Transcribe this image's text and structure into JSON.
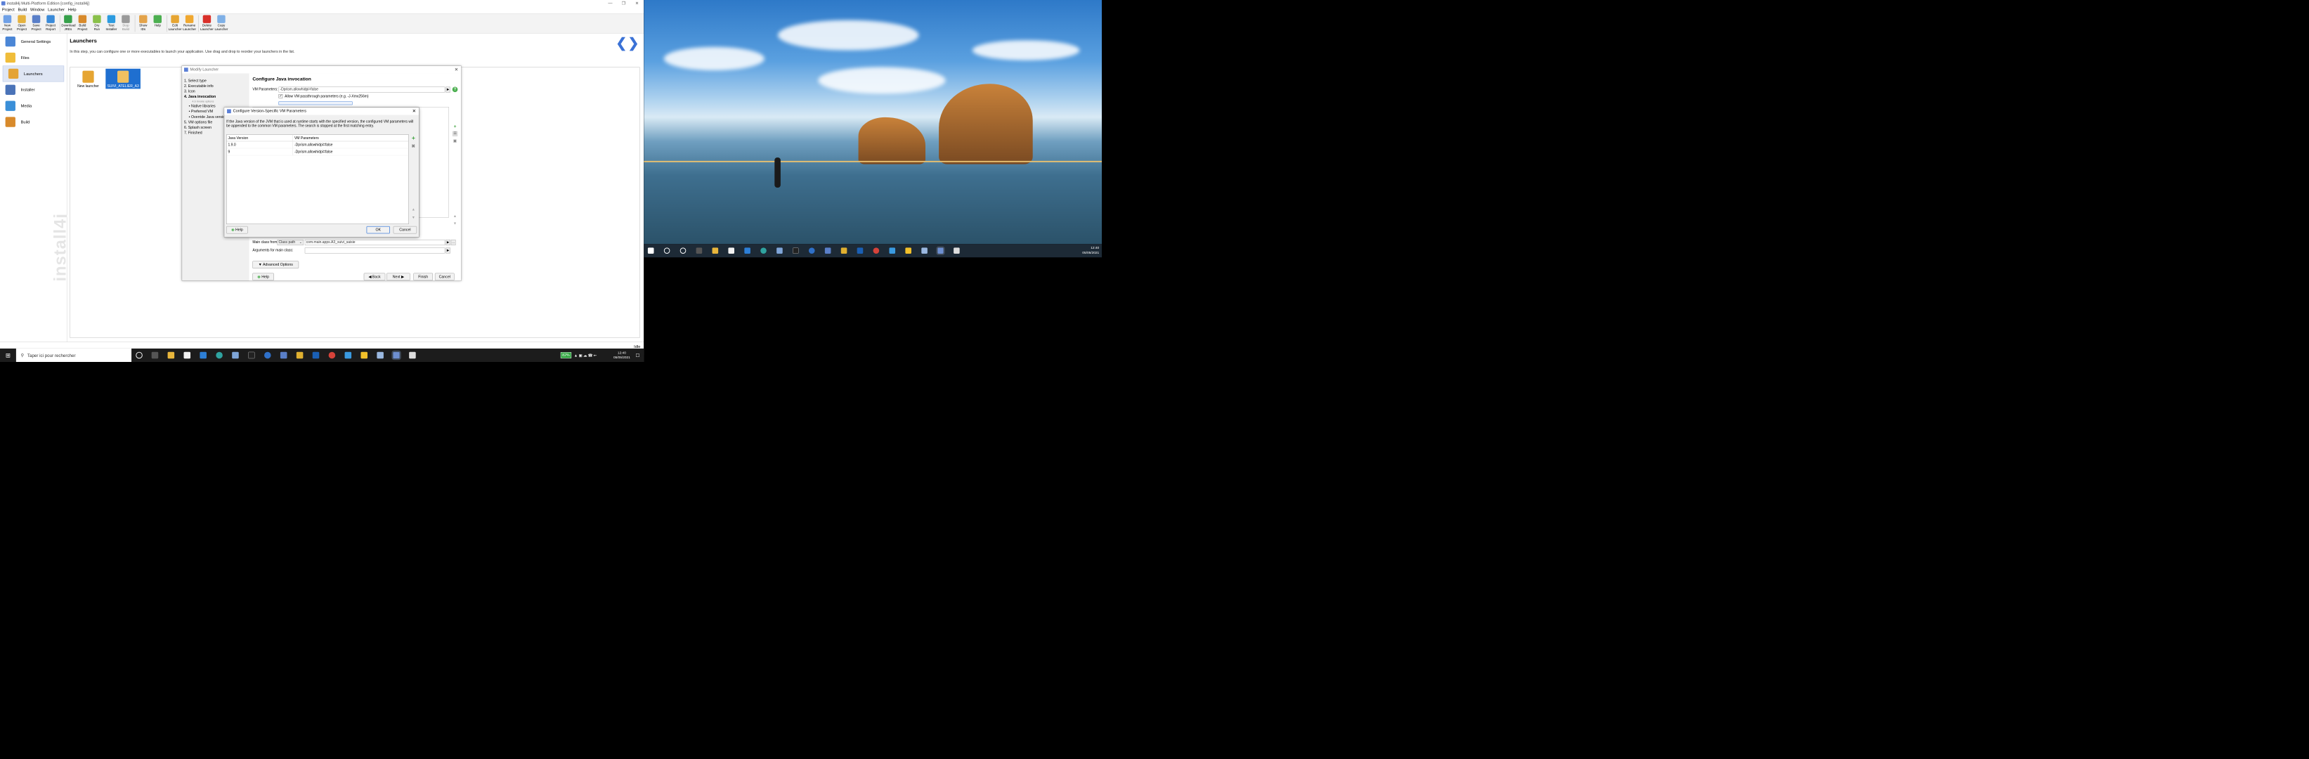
{
  "window": {
    "title": "install4j Multi-Platform Edition [config_install4j]"
  },
  "menu": [
    "Project",
    "Build",
    "Window",
    "Launcher",
    "Help"
  ],
  "toolbar": [
    {
      "label": "New\nProject",
      "color": "#6fa0e6"
    },
    {
      "label": "Open\nProject",
      "color": "#e5b23d"
    },
    {
      "label": "Save\nProject",
      "color": "#5a7fc8"
    },
    {
      "label": "Project\nReport",
      "color": "#3a8ad8"
    },
    {
      "label": "Download\nJREs",
      "color": "#36a04a"
    },
    {
      "label": "Build\nProject",
      "color": "#d88a2b"
    },
    {
      "label": "Dry\nRun",
      "color": "#8ac04a"
    },
    {
      "label": "Test\nInstaller",
      "color": "#2c9be0"
    },
    {
      "label": "Stop\nBuild",
      "color": "#9a9a9a"
    },
    {
      "label": "Show\nIDs",
      "color": "#e3a34a"
    },
    {
      "label": "Help",
      "color": "#4caf50"
    },
    {
      "label": "Edit\nLauncher",
      "color": "#e6a532"
    },
    {
      "label": "Rename\nLauncher",
      "color": "#f0a830"
    },
    {
      "label": "Delete\nLauncher",
      "color": "#d9302a"
    },
    {
      "label": "Copy\nLauncher",
      "color": "#7fb0e6"
    }
  ],
  "sidebar": [
    {
      "label": "General Settings",
      "color": "#4b86d6"
    },
    {
      "label": "Files",
      "color": "#f0bd3a"
    },
    {
      "label": "Launchers",
      "color": "#e4a336"
    },
    {
      "label": "Installer",
      "color": "#4a73b8"
    },
    {
      "label": "Media",
      "color": "#3a8fd8"
    },
    {
      "label": "Build",
      "color": "#d88a2b"
    }
  ],
  "watermark": "install4j",
  "main": {
    "title": "Launchers",
    "description": "In this step, you can configure one or more executables to launch your application. Use drag and drop to reorder your launchers in the list.",
    "launchers": [
      {
        "label": "New launcher"
      },
      {
        "label": "SUIVI_ATELIER_A3"
      }
    ]
  },
  "status": {
    "idle": "Idle"
  },
  "modify_dialog": {
    "title": "Modify Launcher",
    "steps": [
      {
        "label": "1. Select type",
        "cls": ""
      },
      {
        "label": "2. Executable info",
        "cls": ""
      },
      {
        "label": "3. Icon",
        "cls": ""
      },
      {
        "label": "4. Java invocation",
        "cls": "cur"
      },
      {
        "label": "4.b Invoke options",
        "cls": "sub2"
      },
      {
        "label": "• Native libraries",
        "cls": "sub"
      },
      {
        "label": "• Preferred VM",
        "cls": "sub"
      },
      {
        "label": "• Override Java version",
        "cls": "sub"
      },
      {
        "label": "5. VM options file",
        "cls": ""
      },
      {
        "label": "6. Splash screen",
        "cls": ""
      },
      {
        "label": "7. Finished",
        "cls": ""
      }
    ],
    "heading": "Configure Java invocation",
    "vm_params_label": "VM Parameters:",
    "vm_params_value": "-Dprism.allowhidpi=false",
    "passthrough_label": "Allow VM passthrough parameters (e.g. -J-Xmx256m)",
    "main_class_from_label": "Main class from",
    "main_class_source": "Class path",
    "main_class_value": "com.main.apps.A3_suivi_saisie",
    "args_label": "Arguments for main class:",
    "advanced_label": "Advanced Options",
    "help": "Help",
    "back": "Back",
    "next": "Next",
    "finish": "Finish",
    "cancel": "Cancel"
  },
  "vm_dialog": {
    "title": "Configure Version-Specific VM Parameters",
    "message": "If the Java version of the JVM that is used at runtime starts with the specified version, the configured VM parameters will be appended to the common VM parameters. The search is stopped at the first matching entry.",
    "col_version": "Java Version",
    "col_params": "VM Parameters",
    "rows": [
      {
        "version": "1.9.0",
        "params": "-Dprism.allowhidpi=false"
      },
      {
        "version": "9",
        "params": "-Dprism.allowhidpi=false"
      }
    ],
    "help": "Help",
    "ok": "OK",
    "cancel": "Cancel"
  },
  "taskbar_left": {
    "search_placeholder": "Taper ici pour rechercher",
    "battery": "82%",
    "time": "12:40",
    "date": "05/05/2021"
  },
  "taskbar_right": {
    "time": "12:40",
    "date": "05/05/2021"
  }
}
